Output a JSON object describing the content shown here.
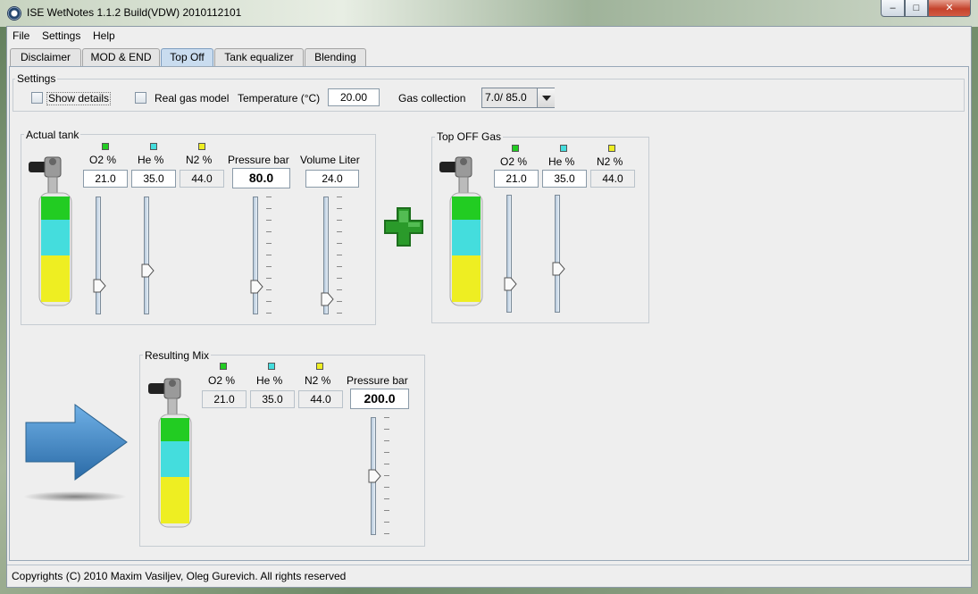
{
  "window": {
    "title": "ISE WetNotes 1.1.2 Build(VDW) 2010112101",
    "minimize_glyph": "–",
    "maximize_glyph": "□",
    "close_glyph": "✕"
  },
  "menu": [
    "File",
    "Settings",
    "Help"
  ],
  "tabs": [
    "Disclaimer",
    "MOD & END",
    "Top Off",
    "Tank equalizer",
    "Blending"
  ],
  "active_tab": "Top Off",
  "settings": {
    "group_label": "Settings",
    "show_details_label": "Show details",
    "real_gas_label": "Real gas model",
    "temperature_label": "Temperature (°C)",
    "temperature_value": "20.00",
    "gas_collection_label": "Gas collection",
    "gas_collection_value": "7.0/ 85.0"
  },
  "actual_tank": {
    "group_label": "Actual tank",
    "o2_label": "O2  %",
    "he_label": "He  %",
    "n2_label": "N2  %",
    "pressure_label": "Pressure  bar",
    "volume_label": "Volume  Liter",
    "o2_value": "21.0",
    "he_value": "35.0",
    "n2_value": "44.0",
    "pressure_value": "80.0",
    "volume_value": "24.0",
    "o2_level": 0.21,
    "he_level": 0.35,
    "pressure_level": 0.2,
    "volume_level": 0.08
  },
  "top_off_gas": {
    "group_label": "Top OFF Gas",
    "o2_label": "O2  %",
    "he_label": "He  %",
    "n2_label": "N2  %",
    "o2_value": "21.0",
    "he_value": "35.0",
    "n2_value": "44.0",
    "o2_level": 0.21,
    "he_level": 0.35
  },
  "resulting_mix": {
    "group_label": "Resulting Mix",
    "o2_label": "O2  %",
    "he_label": "He  %",
    "n2_label": "N2  %",
    "pressure_label": "Pressure  bar",
    "o2_value": "21.0",
    "he_value": "35.0",
    "n2_value": "44.0",
    "pressure_value": "200.0",
    "pressure_level": 0.5
  },
  "colors": {
    "o2": "#22cc22",
    "he": "#44dddd",
    "n2": "#eeee22",
    "plus": "#2a9a2a",
    "arrow": "#3d88c6"
  },
  "icons": {
    "plus": "plus-icon",
    "arrow": "arrow-right-icon",
    "combo": "chevron-down-icon"
  },
  "status": "Copyrights (C) 2010 Maxim Vasiljev, Oleg Gurevich. All rights reserved"
}
